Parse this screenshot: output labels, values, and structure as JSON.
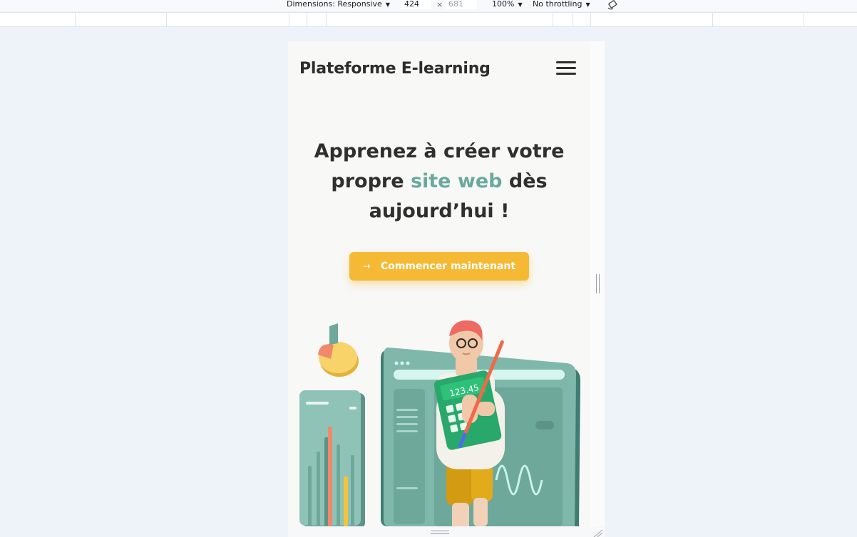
{
  "devtools": {
    "dimensions_label": "Dimensions: Responsive",
    "width_value": "424",
    "height_value": "681",
    "times_symbol": "×",
    "zoom": "100%",
    "throttling": "No throttling",
    "caret": "▼"
  },
  "page": {
    "brand": "Plateforme E-learning",
    "hero": {
      "title_part1": "Apprenez à créer votre propre ",
      "title_accent": "site web",
      "title_part2": " dès aujourd’hui !"
    },
    "cta": {
      "arrow": "→",
      "label": "Commencer maintenant"
    },
    "illustration": {
      "calculator_text": "123.45"
    }
  },
  "colors": {
    "accent_text": "#6aaa9d",
    "cta_background": "#f5b933",
    "heading_text": "#2f2f2f",
    "page_background": "#eef2f9"
  },
  "icons": {
    "menu": "hamburger-icon",
    "cta": "arrow-right-icon",
    "rotate": "rotate-icon"
  }
}
